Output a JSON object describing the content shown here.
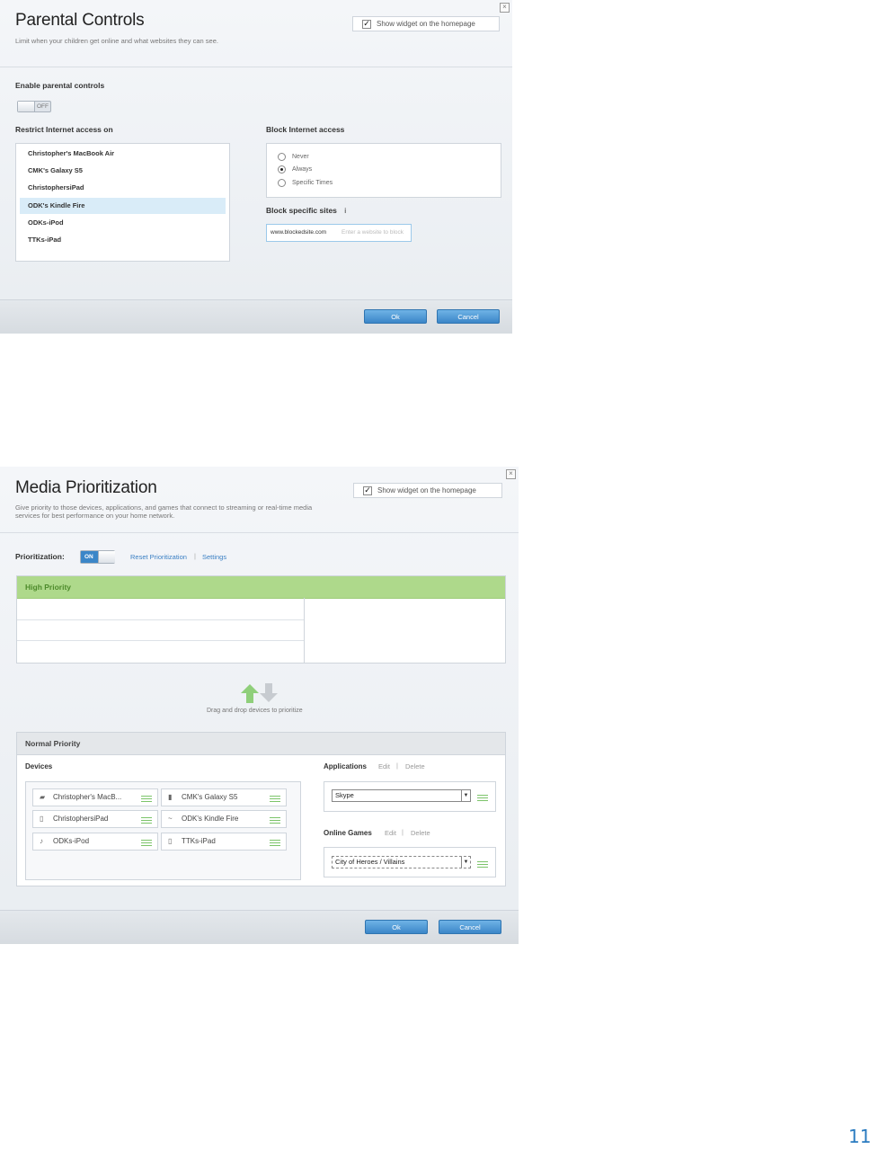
{
  "parental": {
    "title": "Parental Controls",
    "subtitle": "Limit when your children get online and what websites they can see.",
    "widget_label": "Show widget on the homepage",
    "enable_label": "Enable parental controls",
    "toggle_text": "OFF",
    "restrict_label": "Restrict Internet access on",
    "devices": [
      {
        "name": "Christopher's MacBook Air",
        "selected": false
      },
      {
        "name": "CMK's Galaxy S5",
        "selected": false
      },
      {
        "name": "ChristophersiPad",
        "selected": false
      },
      {
        "name": "ODK's Kindle Fire",
        "selected": true
      },
      {
        "name": "ODKs-iPod",
        "selected": false
      },
      {
        "name": "TTKs-iPad",
        "selected": false
      }
    ],
    "block_access_label": "Block Internet access",
    "block_options": [
      {
        "label": "Never",
        "selected": false
      },
      {
        "label": "Always",
        "selected": true
      },
      {
        "label": "Specific Times",
        "selected": false
      }
    ],
    "block_sites_label": "Block specific sites",
    "block_sites_info": "i",
    "blocked_site": "www.blockedsite.com",
    "site_placeholder": "Enter a website to block",
    "ok_label": "Ok",
    "cancel_label": "Cancel"
  },
  "media": {
    "title": "Media Prioritization",
    "subtitle_line1": "Give priority to those devices, applications, and games that connect to streaming or real-time media",
    "subtitle_line2": "services for best performance on your home network.",
    "widget_label": "Show widget on the homepage",
    "prioritization_label": "Prioritization:",
    "toggle_text": "ON",
    "reset_link": "Reset Prioritization",
    "separator": "|",
    "settings_link": "Settings",
    "high_priority_label": "High Priority",
    "drag_hint": "Drag and drop devices to prioritize",
    "normal_priority_label": "Normal Priority",
    "devices_label": "Devices",
    "devices": [
      {
        "name": "Christopher's MacB...",
        "icon": "laptop-icon"
      },
      {
        "name": "CMK's Galaxy S5",
        "icon": "phone-icon"
      },
      {
        "name": "ChristophersiPad",
        "icon": "tablet-icon"
      },
      {
        "name": "ODK's Kindle Fire",
        "icon": "device-icon"
      },
      {
        "name": "ODKs-iPod",
        "icon": "media-player-icon"
      },
      {
        "name": "TTKs-iPad",
        "icon": "tablet-icon"
      }
    ],
    "applications_label": "Applications",
    "edit_label": "Edit",
    "delete_label": "Delete",
    "application_selected": "Skype",
    "online_games_label": "Online Games",
    "game_selected": "City of Heroes / Villains",
    "ok_label": "Ok",
    "cancel_label": "Cancel"
  },
  "page_number": "11",
  "colors": {
    "accent": "#3b86c8",
    "high_priority": "#aed98b",
    "page_number": "#2a7bc0"
  }
}
